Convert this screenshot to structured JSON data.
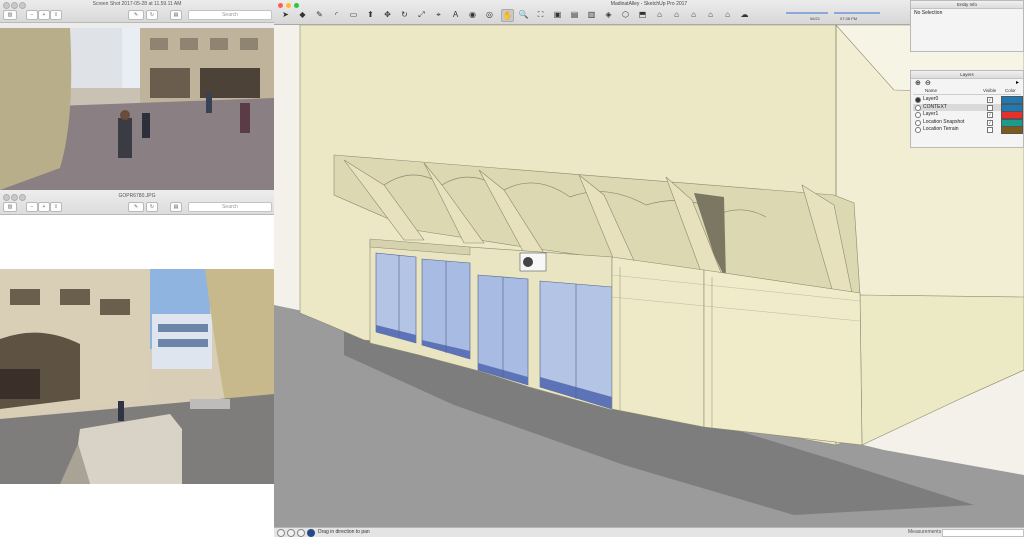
{
  "preview_top": {
    "title": "Screen Shot 2017-05-28 at 11.59.11 AM",
    "search_placeholder": "Search",
    "toolbar_icons": [
      "sidebar-icon",
      "zoom-out-icon",
      "zoom-in-icon",
      "share-icon",
      "markup-icon",
      "rotate-icon",
      "toolbox-icon"
    ]
  },
  "preview_bottom": {
    "title": "GOPR6780.JPG",
    "search_placeholder": "Search",
    "toolbar_icons": [
      "sidebar-icon",
      "zoom-out-icon",
      "zoom-in-icon",
      "share-icon",
      "markup-icon",
      "rotate-icon",
      "toolbox-icon"
    ]
  },
  "sketchup": {
    "title": "MadinatAlley - SketchUp Pro 2017",
    "shadow_time_label": "06/21",
    "shadow_clock_label": "07:38 PM",
    "tools": [
      {
        "icon": "select-arrow-icon",
        "glyph": "➤"
      },
      {
        "icon": "eraser-icon",
        "glyph": "◆"
      },
      {
        "icon": "pencil-icon",
        "glyph": "✎"
      },
      {
        "icon": "arc-icon",
        "glyph": "◜"
      },
      {
        "icon": "rectangle-icon",
        "glyph": "▭"
      },
      {
        "icon": "push-pull-icon",
        "glyph": "⬆"
      },
      {
        "icon": "move-icon",
        "glyph": "✥"
      },
      {
        "icon": "rotate-icon",
        "glyph": "↻"
      },
      {
        "icon": "scale-icon",
        "glyph": "⤢"
      },
      {
        "icon": "tape-measure-icon",
        "glyph": "⌖"
      },
      {
        "icon": "text-icon",
        "glyph": "A"
      },
      {
        "icon": "paint-bucket-icon",
        "glyph": "◉"
      },
      {
        "icon": "orbit-icon",
        "glyph": "◎"
      },
      {
        "icon": "pan-hand-icon",
        "glyph": "✋"
      },
      {
        "icon": "zoom-icon",
        "glyph": "🔍"
      },
      {
        "icon": "zoom-extents-icon",
        "glyph": "⛶"
      },
      {
        "icon": "warehouse-icon",
        "glyph": "▣"
      },
      {
        "icon": "extension-warehouse-icon",
        "glyph": "▤"
      },
      {
        "icon": "layout-icon",
        "glyph": "▥"
      },
      {
        "icon": "ruby-icon",
        "glyph": "◈"
      },
      {
        "icon": "iso-view-icon",
        "glyph": "⬡"
      },
      {
        "icon": "top-view-icon",
        "glyph": "⬒"
      },
      {
        "icon": "front-view-icon",
        "glyph": "⌂"
      },
      {
        "icon": "right-view-icon",
        "glyph": "⌂"
      },
      {
        "icon": "back-view-icon",
        "glyph": "⌂"
      },
      {
        "icon": "left-view-icon",
        "glyph": "⌂"
      },
      {
        "icon": "bottom-view-icon",
        "glyph": "⌂"
      },
      {
        "icon": "shadows-icon",
        "glyph": "☁"
      }
    ],
    "status_hint": "Drag in direction to pan",
    "measurements_label": "Measurements"
  },
  "entity_info": {
    "title": "Entity Info",
    "selection": "No Selection"
  },
  "layers": {
    "title": "Layers",
    "col_name": "Name",
    "col_visible": "Visible",
    "col_color": "Color",
    "rows": [
      {
        "name": "Layer0",
        "visible": true,
        "color": "#1f7ab4",
        "active": true
      },
      {
        "name": "CONTEXT",
        "visible": false,
        "color": "#1f7ab4",
        "active": false
      },
      {
        "name": "Layer1",
        "visible": true,
        "color": "#e8302a",
        "active": false
      },
      {
        "name": "Location Snapshot",
        "visible": true,
        "color": "#1f9a8a",
        "active": false
      },
      {
        "name": "Location Terrain",
        "visible": false,
        "color": "#7d5a1a",
        "active": false
      }
    ]
  }
}
